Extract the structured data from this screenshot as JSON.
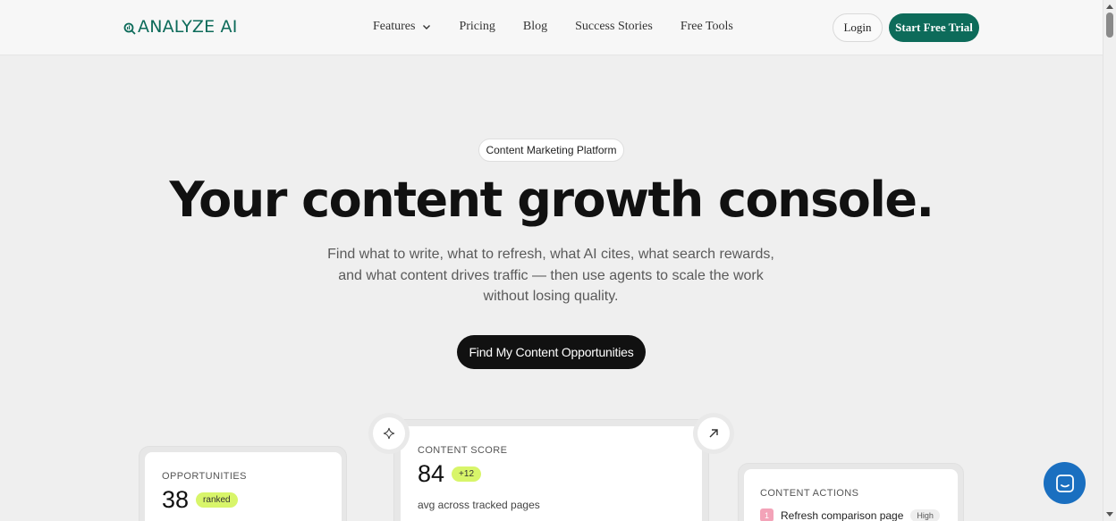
{
  "header": {
    "logo_text": "ANALYZE AI",
    "nav": [
      {
        "label": "Features",
        "has_dropdown": true
      },
      {
        "label": "Pricing"
      },
      {
        "label": "Blog"
      },
      {
        "label": "Success Stories"
      },
      {
        "label": "Free Tools"
      }
    ],
    "login_label": "Login",
    "trial_label": "Start Free Trial"
  },
  "hero": {
    "eyebrow": "Content Marketing Platform",
    "headline": "Your content growth console.",
    "subhead": "Find what to write, what to refresh, what AI cites, what search rewards, and what content drives traffic — then use agents to scale the work without losing quality.",
    "cta_label": "Find My Content Opportunities"
  },
  "cards": {
    "opportunities": {
      "label": "OPPORTUNITIES",
      "value": "38",
      "badge": "ranked"
    },
    "content_score": {
      "label": "CONTENT SCORE",
      "value": "84",
      "badge": "+12",
      "caption": "avg across tracked pages"
    },
    "content_actions": {
      "label": "CONTENT ACTIONS",
      "item_number": "1",
      "item_label": "Refresh comparison page",
      "item_priority": "High"
    }
  },
  "colors": {
    "brand": "#0d6b5a",
    "accent_lime": "#d8f56a",
    "chat_blue": "#1a6fc0"
  },
  "icons": [
    "logo-mark-icon",
    "chevron-down-icon",
    "sparkle-icon",
    "arrow-up-right-icon",
    "chat-icon"
  ]
}
